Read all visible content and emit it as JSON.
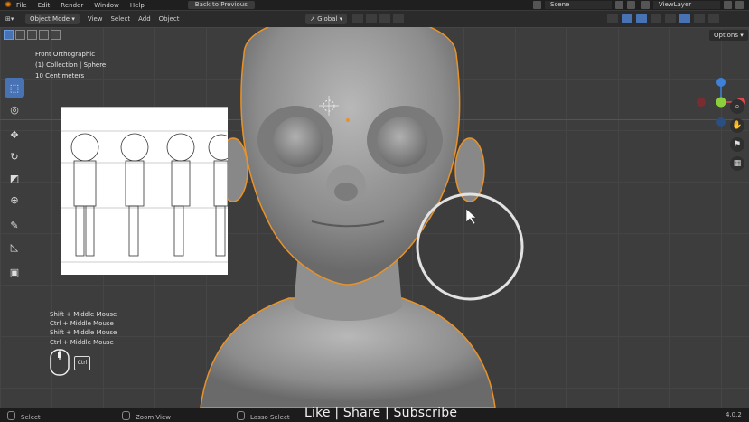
{
  "topbar": {
    "menus": [
      "File",
      "Edit",
      "Render",
      "Window",
      "Help"
    ],
    "back_button": "Back to Previous",
    "scene": "Scene",
    "view_layer": "ViewLayer"
  },
  "header": {
    "mode": "Object Mode",
    "menus": [
      "View",
      "Select",
      "Add",
      "Object"
    ],
    "orientation": "Global",
    "options": "Options"
  },
  "viewport": {
    "view_name": "Front Orthographic",
    "collection": "(1) Collection | Sphere",
    "scale": "10 Centimeters"
  },
  "shortcuts": [
    "Shift + Middle Mouse",
    "Ctrl + Middle Mouse",
    "Shift + Middle Mouse",
    "Ctrl + Middle Mouse"
  ],
  "ctrl_key": "Ctrl",
  "status": {
    "left": "Select",
    "middle": "Zoom View",
    "right": "Lasso Select",
    "version": "4.0.2"
  },
  "overlay_caption": "Like | Share | Subscribe",
  "colors": {
    "accent": "#4772b3",
    "selection_outline": "#e8922a",
    "x_axis": "#e0484f",
    "y_axis": "#8bcf3c",
    "z_axis": "#3d82d8"
  }
}
